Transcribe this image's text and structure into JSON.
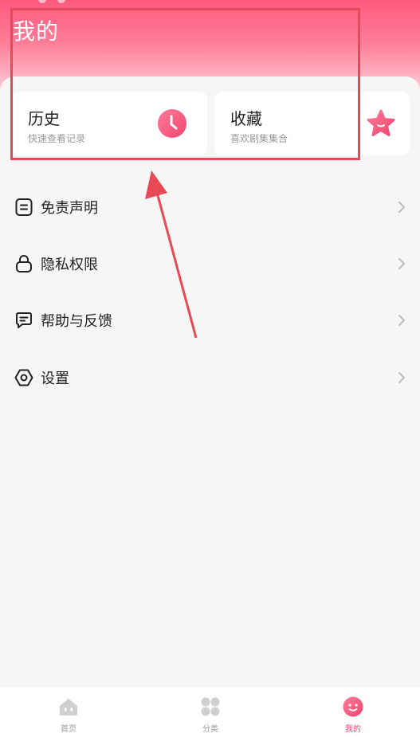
{
  "header": {
    "title": "我的"
  },
  "cards": {
    "history": {
      "title": "历史",
      "subtitle": "快速查看记录",
      "icon": "clock-icon"
    },
    "favorites": {
      "title": "收藏",
      "subtitle": "喜欢剧集集合",
      "icon": "star-icon"
    }
  },
  "menu": [
    {
      "label": "免责声明",
      "icon": "document-icon"
    },
    {
      "label": "隐私权限",
      "icon": "lock-icon"
    },
    {
      "label": "帮助与反馈",
      "icon": "chat-icon"
    },
    {
      "label": "设置",
      "icon": "settings-hexagon-icon"
    }
  ],
  "tabbar": [
    {
      "label": "首页",
      "icon": "home-icon",
      "active": false
    },
    {
      "label": "分类",
      "icon": "category-grid-icon",
      "active": false
    },
    {
      "label": "我的",
      "icon": "smiley-icon",
      "active": true
    }
  ],
  "colors": {
    "accent": "#f0476e",
    "annotation_red": "#e84a55"
  }
}
